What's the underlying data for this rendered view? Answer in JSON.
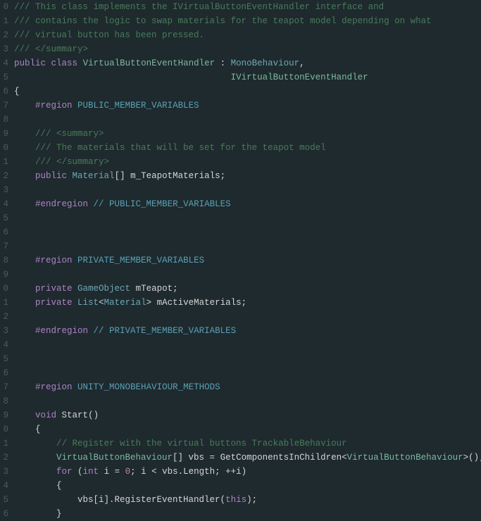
{
  "gutter_start": 0,
  "lines": [
    [
      {
        "t": "/// This class implements the IVirtualButtonEventHandler interface and",
        "c": "c-comment"
      }
    ],
    [
      {
        "t": "/// contains the logic to swap materials for the teapot model depending on what",
        "c": "c-comment"
      }
    ],
    [
      {
        "t": "/// virtual button has been pressed.",
        "c": "c-comment"
      }
    ],
    [
      {
        "t": "/// </summary>",
        "c": "c-comment"
      }
    ],
    [
      {
        "t": "public",
        "c": "c-keyword"
      },
      {
        "t": " ",
        "c": "c-text"
      },
      {
        "t": "class",
        "c": "c-keyword"
      },
      {
        "t": " ",
        "c": "c-text"
      },
      {
        "t": "VirtualButtonEventHandler",
        "c": "c-type"
      },
      {
        "t": " : ",
        "c": "c-text"
      },
      {
        "t": "MonoBehaviour",
        "c": "c-attr"
      },
      {
        "t": ",",
        "c": "c-text"
      }
    ],
    [
      {
        "t": "                                         ",
        "c": "c-text"
      },
      {
        "t": "IVirtualButtonEventHandler",
        "c": "c-type"
      }
    ],
    [
      {
        "t": "{",
        "c": "c-text"
      }
    ],
    [
      {
        "t": "    ",
        "c": "c-text"
      },
      {
        "t": "#region",
        "c": "c-keyword"
      },
      {
        "t": " ",
        "c": "c-text"
      },
      {
        "t": "PUBLIC_MEMBER_VARIABLES",
        "c": "c-region"
      }
    ],
    [
      {
        "t": "",
        "c": "c-text"
      }
    ],
    [
      {
        "t": "    ",
        "c": "c-text"
      },
      {
        "t": "/// <summary>",
        "c": "c-comment"
      }
    ],
    [
      {
        "t": "    ",
        "c": "c-text"
      },
      {
        "t": "/// The materials that will be set for the teapot model",
        "c": "c-comment"
      }
    ],
    [
      {
        "t": "    ",
        "c": "c-text"
      },
      {
        "t": "/// </summary>",
        "c": "c-comment"
      }
    ],
    [
      {
        "t": "    ",
        "c": "c-text"
      },
      {
        "t": "public",
        "c": "c-keyword"
      },
      {
        "t": " ",
        "c": "c-text"
      },
      {
        "t": "Material",
        "c": "c-attr"
      },
      {
        "t": "[] ",
        "c": "c-text"
      },
      {
        "t": "m_TeapotMaterials",
        "c": "c-field"
      },
      {
        "t": ";",
        "c": "c-text"
      }
    ],
    [
      {
        "t": "",
        "c": "c-text"
      }
    ],
    [
      {
        "t": "    ",
        "c": "c-text"
      },
      {
        "t": "#endregion",
        "c": "c-keyword"
      },
      {
        "t": " ",
        "c": "c-text"
      },
      {
        "t": "// PUBLIC_MEMBER_VARIABLES",
        "c": "c-region"
      }
    ],
    [
      {
        "t": "",
        "c": "c-text"
      }
    ],
    [
      {
        "t": "",
        "c": "c-text"
      }
    ],
    [
      {
        "t": "",
        "c": "c-text"
      }
    ],
    [
      {
        "t": "    ",
        "c": "c-text"
      },
      {
        "t": "#region",
        "c": "c-keyword"
      },
      {
        "t": " ",
        "c": "c-text"
      },
      {
        "t": "PRIVATE_MEMBER_VARIABLES",
        "c": "c-region"
      }
    ],
    [
      {
        "t": "",
        "c": "c-text"
      }
    ],
    [
      {
        "t": "    ",
        "c": "c-text"
      },
      {
        "t": "private",
        "c": "c-keyword"
      },
      {
        "t": " ",
        "c": "c-text"
      },
      {
        "t": "GameObject",
        "c": "c-attr"
      },
      {
        "t": " mTeapot;",
        "c": "c-text"
      }
    ],
    [
      {
        "t": "    ",
        "c": "c-text"
      },
      {
        "t": "private",
        "c": "c-keyword"
      },
      {
        "t": " ",
        "c": "c-text"
      },
      {
        "t": "List",
        "c": "c-attr"
      },
      {
        "t": "<",
        "c": "c-text"
      },
      {
        "t": "Material",
        "c": "c-attr"
      },
      {
        "t": "> mActiveMaterials;",
        "c": "c-text"
      }
    ],
    [
      {
        "t": "",
        "c": "c-text"
      }
    ],
    [
      {
        "t": "    ",
        "c": "c-text"
      },
      {
        "t": "#endregion",
        "c": "c-keyword"
      },
      {
        "t": " ",
        "c": "c-text"
      },
      {
        "t": "// PRIVATE_MEMBER_VARIABLES",
        "c": "c-region"
      }
    ],
    [
      {
        "t": "",
        "c": "c-text"
      }
    ],
    [
      {
        "t": "",
        "c": "c-text"
      }
    ],
    [
      {
        "t": "",
        "c": "c-text"
      }
    ],
    [
      {
        "t": "    ",
        "c": "c-text"
      },
      {
        "t": "#region",
        "c": "c-keyword"
      },
      {
        "t": " ",
        "c": "c-text"
      },
      {
        "t": "UNITY_MONOBEHAVIOUR_METHODS",
        "c": "c-region"
      }
    ],
    [
      {
        "t": "",
        "c": "c-text"
      }
    ],
    [
      {
        "t": "    ",
        "c": "c-text"
      },
      {
        "t": "void",
        "c": "c-keyword"
      },
      {
        "t": " ",
        "c": "c-text"
      },
      {
        "t": "Start",
        "c": "c-func"
      },
      {
        "t": "()",
        "c": "c-text"
      }
    ],
    [
      {
        "t": "    {",
        "c": "c-text"
      }
    ],
    [
      {
        "t": "        ",
        "c": "c-text"
      },
      {
        "t": "// Register with the virtual buttons TrackableBehaviour",
        "c": "c-comment"
      }
    ],
    [
      {
        "t": "        ",
        "c": "c-text"
      },
      {
        "t": "VirtualButtonBehaviour",
        "c": "c-type"
      },
      {
        "t": "[] vbs = ",
        "c": "c-text"
      },
      {
        "t": "GetComponentsInChildren",
        "c": "c-func"
      },
      {
        "t": "<",
        "c": "c-text"
      },
      {
        "t": "VirtualButtonBehaviour",
        "c": "c-type"
      },
      {
        "t": ">();",
        "c": "c-text"
      }
    ],
    [
      {
        "t": "        ",
        "c": "c-text"
      },
      {
        "t": "for",
        "c": "c-keyword"
      },
      {
        "t": " (",
        "c": "c-text"
      },
      {
        "t": "int",
        "c": "c-keyword"
      },
      {
        "t": " i = ",
        "c": "c-text"
      },
      {
        "t": "0",
        "c": "c-num"
      },
      {
        "t": "; i < vbs.Length; ++i)",
        "c": "c-text"
      }
    ],
    [
      {
        "t": "        {",
        "c": "c-text"
      }
    ],
    [
      {
        "t": "            vbs[i].RegisterEventHandler(",
        "c": "c-text"
      },
      {
        "t": "this",
        "c": "c-keyword"
      },
      {
        "t": ");",
        "c": "c-text"
      }
    ],
    [
      {
        "t": "        }",
        "c": "c-text"
      }
    ]
  ]
}
